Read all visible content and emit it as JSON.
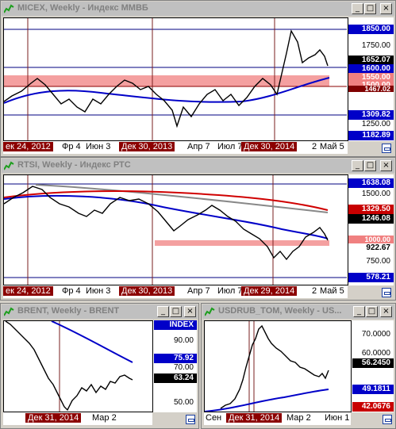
{
  "colors": {
    "title_text": "#808080",
    "price_up": "#000000",
    "price_box": "#000000",
    "blue_box": "#0000c8",
    "red_box": "#c80000",
    "pink_box": "#f08080",
    "dark_red_box": "#800000",
    "grid_line": "#7a1f1f"
  },
  "windows": [
    {
      "title": "MICEX, Weekly - Индекс ММВБ",
      "buttons": {
        "minimize": "_",
        "maximize": "□",
        "close": "×"
      },
      "price_labels": [
        {
          "text": "1850.00",
          "kind": "blue",
          "value": 1850
        },
        {
          "text": "1750.00",
          "kind": "plain",
          "value": 1750
        },
        {
          "text": "1652.07",
          "kind": "black",
          "value": 1652.07
        },
        {
          "text": "1600.00",
          "kind": "blue",
          "value": 1600
        },
        {
          "text": "1550.00",
          "kind": "pink",
          "value": 1550
        },
        {
          "text": "1500.00",
          "kind": "pink",
          "value": 1500
        },
        {
          "text": "1467.02",
          "kind": "darkred",
          "value": 1467.02
        },
        {
          "text": "1309.82",
          "kind": "blue",
          "value": 1309.82
        },
        {
          "text": "1250.00",
          "kind": "plain",
          "value": 1250
        },
        {
          "text": "1182.89",
          "kind": "blue",
          "value": 1182.89
        }
      ],
      "x_labels": [
        {
          "text": "ек 24, 2012",
          "hl": true
        },
        {
          "text": "Фр 4",
          "hl": false
        },
        {
          "text": "Июн 3",
          "hl": false
        },
        {
          "text": "Дек 30, 2013",
          "hl": true
        },
        {
          "text": "Апр 7",
          "hl": false
        },
        {
          "text": "Июл 7",
          "hl": false
        },
        {
          "text": "Дек 30, 2014",
          "hl": true
        },
        {
          "text": "2",
          "hl": false
        },
        {
          "text": "Май 5",
          "hl": false
        }
      ]
    },
    {
      "title": "RTSI, Weekly - Индекс РТС",
      "buttons": {
        "minimize": "_",
        "maximize": "□",
        "close": "×"
      },
      "price_labels": [
        {
          "text": "1638.08",
          "kind": "blue",
          "value": 1638.08
        },
        {
          "text": "1500.00",
          "kind": "plain",
          "value": 1500
        },
        {
          "text": "1329.50",
          "kind": "red",
          "value": 1329.5
        },
        {
          "text": "1246.08",
          "kind": "black",
          "value": 1246.08
        },
        {
          "text": "1000.00",
          "kind": "pink",
          "value": 1000
        },
        {
          "text": "922.67",
          "kind": "black",
          "value": 922.67
        },
        {
          "text": "750.00",
          "kind": "plain",
          "value": 750
        },
        {
          "text": "578.21",
          "kind": "blue",
          "value": 578.21
        }
      ],
      "x_labels": [
        {
          "text": "ек 24, 2012",
          "hl": true
        },
        {
          "text": "Фр 4",
          "hl": false
        },
        {
          "text": "Июн 3",
          "hl": false
        },
        {
          "text": "Дек 30, 2013",
          "hl": true
        },
        {
          "text": "Апр 7",
          "hl": false
        },
        {
          "text": "Июл 7",
          "hl": false
        },
        {
          "text": "Дек 29, 2014",
          "hl": true
        },
        {
          "text": "2",
          "hl": false
        },
        {
          "text": "Май 5",
          "hl": false
        }
      ]
    },
    {
      "title": "BRENT, Weekly - BRENT",
      "buttons": {
        "minimize": "_",
        "maximize": "□",
        "close": "×"
      },
      "price_labels": [
        {
          "text": "INDEX",
          "kind": "blue",
          "value": 100
        },
        {
          "text": "90.00",
          "kind": "plain",
          "value": 90
        },
        {
          "text": "75.92",
          "kind": "blue",
          "value": 75.92
        },
        {
          "text": "70.00",
          "kind": "plain",
          "value": 70
        },
        {
          "text": "63.24",
          "kind": "black",
          "value": 63.24
        },
        {
          "text": "50.00",
          "kind": "plain",
          "value": 50
        }
      ],
      "x_labels": [
        {
          "text": "Дек 31, 2014",
          "hl": true
        },
        {
          "text": "Мар 2",
          "hl": false
        }
      ]
    },
    {
      "title": "USDRUB_TOM, Weekly - US...",
      "buttons": {
        "minimize": "_",
        "maximize": "□",
        "close": "×"
      },
      "price_labels": [
        {
          "text": "70.0000",
          "kind": "plain",
          "value": 70
        },
        {
          "text": "60.0000",
          "kind": "plain",
          "value": 60
        },
        {
          "text": "56.2450",
          "kind": "black",
          "value": 56.245
        },
        {
          "text": "49.1811",
          "kind": "blue",
          "value": 49.1811
        },
        {
          "text": "42.0676",
          "kind": "red",
          "value": 42.0676
        }
      ],
      "x_labels": [
        {
          "text": "Сен",
          "hl": false
        },
        {
          "text": "Дек 31, 2014",
          "hl": true
        },
        {
          "text": "Мар 2",
          "hl": false
        },
        {
          "text": "Июн 1",
          "hl": false
        }
      ]
    }
  ]
}
